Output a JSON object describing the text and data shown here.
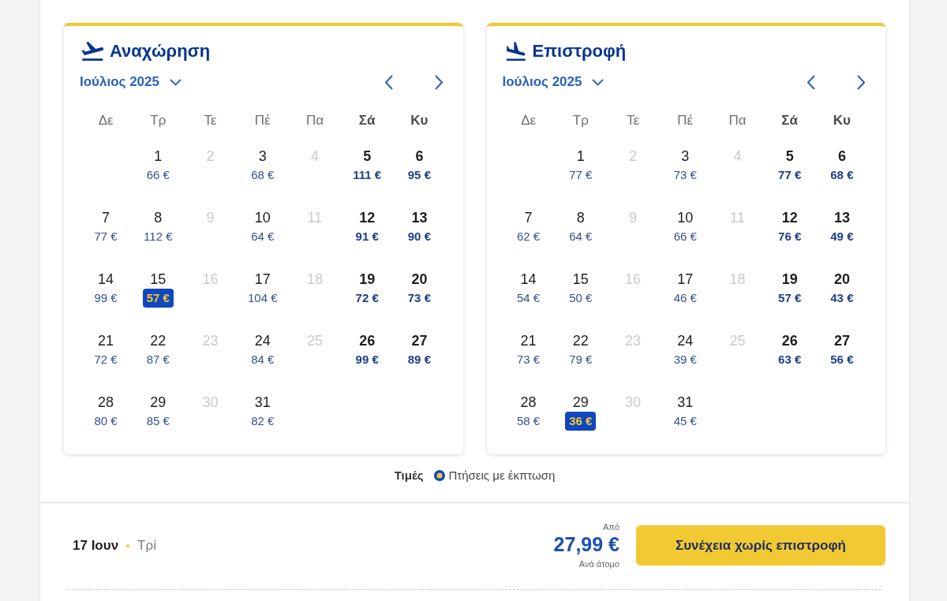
{
  "calendars": [
    {
      "kind": "departure",
      "title": "Αναχώρηση",
      "month": "Ιούλιος 2025",
      "weekdays": [
        {
          "label": "Δε",
          "weekend": false
        },
        {
          "label": "Τρ",
          "weekend": false
        },
        {
          "label": "Τε",
          "weekend": false
        },
        {
          "label": "Πέ",
          "weekend": false
        },
        {
          "label": "Πα",
          "weekend": false
        },
        {
          "label": "Σά",
          "weekend": true
        },
        {
          "label": "Κυ",
          "weekend": true
        }
      ],
      "weeks": [
        {
          "days": [
            {
              "kind": "fare",
              "day": "1",
              "price": "66 €"
            },
            {
              "kind": "unavailable",
              "day": "2"
            },
            {
              "kind": "fare",
              "day": "3",
              "price": "68 €"
            },
            {
              "kind": "unavailable",
              "day": "4"
            },
            {
              "kind": "fare",
              "day": "5",
              "price": "111 €"
            },
            {
              "kind": "fare",
              "day": "6",
              "price": "95 €"
            }
          ]
        },
        {
          "days": [
            {
              "kind": "fare",
              "day": "7",
              "price": "77 €"
            },
            {
              "kind": "fare",
              "day": "8",
              "price": "112 €"
            },
            {
              "kind": "unavailable",
              "day": "9"
            },
            {
              "kind": "fare",
              "day": "10",
              "price": "64 €"
            },
            {
              "kind": "unavailable",
              "day": "11"
            },
            {
              "kind": "fare",
              "day": "12",
              "price": "91 €"
            },
            {
              "kind": "fare",
              "day": "13",
              "price": "90 €"
            }
          ]
        },
        {
          "days": [
            {
              "kind": "fare",
              "day": "14",
              "price": "99 €"
            },
            {
              "kind": "discount",
              "day": "15",
              "price": "57 €"
            },
            {
              "kind": "unavailable",
              "day": "16"
            },
            {
              "kind": "fare",
              "day": "17",
              "price": "104 €"
            },
            {
              "kind": "unavailable",
              "day": "18"
            },
            {
              "kind": "fare",
              "day": "19",
              "price": "72 €"
            },
            {
              "kind": "fare",
              "day": "20",
              "price": "73 €"
            }
          ]
        },
        {
          "days": [
            {
              "kind": "fare",
              "day": "21",
              "price": "72 €"
            },
            {
              "kind": "fare",
              "day": "22",
              "price": "87 €"
            },
            {
              "kind": "unavailable",
              "day": "23"
            },
            {
              "kind": "fare",
              "day": "24",
              "price": "84 €"
            },
            {
              "kind": "unavailable",
              "day": "25"
            },
            {
              "kind": "fare",
              "day": "26",
              "price": "99 €"
            },
            {
              "kind": "fare",
              "day": "27",
              "price": "89 €"
            }
          ]
        },
        {
          "days": [
            {
              "kind": "fare",
              "day": "28",
              "price": "80 €"
            },
            {
              "kind": "fare",
              "day": "29",
              "price": "85 €"
            },
            {
              "kind": "unavailable",
              "day": "30"
            },
            {
              "kind": "fare",
              "day": "31",
              "price": "82 €"
            }
          ]
        }
      ]
    },
    {
      "kind": "return",
      "title": "Επιστροφή",
      "month": "Ιούλιος 2025",
      "weekdays": [
        {
          "label": "Δε",
          "weekend": false
        },
        {
          "label": "Τρ",
          "weekend": false
        },
        {
          "label": "Τε",
          "weekend": false
        },
        {
          "label": "Πέ",
          "weekend": false
        },
        {
          "label": "Πα",
          "weekend": false
        },
        {
          "label": "Σά",
          "weekend": true
        },
        {
          "label": "Κυ",
          "weekend": true
        }
      ],
      "weeks": [
        {
          "days": [
            {
              "kind": "fare",
              "day": "1",
              "price": "77 €"
            },
            {
              "kind": "unavailable",
              "day": "2"
            },
            {
              "kind": "fare",
              "day": "3",
              "price": "73 €"
            },
            {
              "kind": "unavailable",
              "day": "4"
            },
            {
              "kind": "fare",
              "day": "5",
              "price": "77 €"
            },
            {
              "kind": "fare",
              "day": "6",
              "price": "68 €"
            }
          ]
        },
        {
          "days": [
            {
              "kind": "fare",
              "day": "7",
              "price": "62 €"
            },
            {
              "kind": "fare",
              "day": "8",
              "price": "64 €"
            },
            {
              "kind": "unavailable",
              "day": "9"
            },
            {
              "kind": "fare",
              "day": "10",
              "price": "66 €"
            },
            {
              "kind": "unavailable",
              "day": "11"
            },
            {
              "kind": "fare",
              "day": "12",
              "price": "76 €"
            },
            {
              "kind": "fare",
              "day": "13",
              "price": "49 €"
            }
          ]
        },
        {
          "days": [
            {
              "kind": "fare",
              "day": "14",
              "price": "54 €"
            },
            {
              "kind": "fare",
              "day": "15",
              "price": "50 €"
            },
            {
              "kind": "unavailable",
              "day": "16"
            },
            {
              "kind": "fare",
              "day": "17",
              "price": "46 €"
            },
            {
              "kind": "unavailable",
              "day": "18"
            },
            {
              "kind": "fare",
              "day": "19",
              "price": "57 €"
            },
            {
              "kind": "fare",
              "day": "20",
              "price": "43 €"
            }
          ]
        },
        {
          "days": [
            {
              "kind": "fare",
              "day": "21",
              "price": "73 €"
            },
            {
              "kind": "fare",
              "day": "22",
              "price": "79 €"
            },
            {
              "kind": "unavailable",
              "day": "23"
            },
            {
              "kind": "fare",
              "day": "24",
              "price": "39 €"
            },
            {
              "kind": "unavailable",
              "day": "25"
            },
            {
              "kind": "fare",
              "day": "26",
              "price": "63 €"
            },
            {
              "kind": "fare",
              "day": "27",
              "price": "56 €"
            }
          ]
        },
        {
          "days": [
            {
              "kind": "fare",
              "day": "28",
              "price": "58 €"
            },
            {
              "kind": "discount",
              "day": "29",
              "price": "36 €"
            },
            {
              "kind": "unavailable",
              "day": "30"
            },
            {
              "kind": "fare",
              "day": "31",
              "price": "45 €"
            }
          ]
        }
      ]
    }
  ],
  "legend": {
    "title": "Τιμές",
    "label": "Πτήσεις με έκπτωση"
  },
  "summary": {
    "date": "17 Ιουν",
    "weekday": "Τρί",
    "price_prefix": "Από",
    "price": "27,99 €",
    "price_suffix": "Ανά άτομο",
    "button": "Συνέχεια χωρίς επιστροφή"
  }
}
